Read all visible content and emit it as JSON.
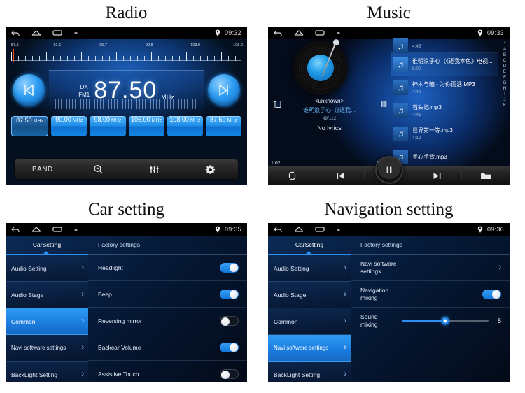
{
  "panels": {
    "radio": {
      "title": "Radio",
      "statusbar": {
        "time": "09:32",
        "icons": [
          "back-icon",
          "home-icon",
          "recents-icon",
          "square-icon",
          "location-pin-icon"
        ]
      },
      "scale": {
        "labels": [
          "87.5",
          "91.6",
          "95.7",
          "99.8",
          "103.9",
          "108.0"
        ],
        "cursor_label": "87.5"
      },
      "band_mode": "DX",
      "band": "FM1",
      "frequency": "87.50",
      "unit": "MHz",
      "prev_icon": "skip-previous-icon",
      "next_icon": "skip-next-icon",
      "presets": [
        {
          "value": "87.50",
          "unit": "MHz",
          "active": true
        },
        {
          "value": "90.00",
          "unit": "MHz",
          "active": false
        },
        {
          "value": "98.00",
          "unit": "MHz",
          "active": false
        },
        {
          "value": "106.00",
          "unit": "MHz",
          "active": false
        },
        {
          "value": "108.00",
          "unit": "MHz",
          "active": false
        },
        {
          "value": "87.50",
          "unit": "MHz",
          "active": false
        }
      ],
      "toolbar": {
        "band_label": "BAND",
        "scan_icon": "search-scan-icon",
        "equalizer_icon": "equalizer-icon",
        "settings_icon": "gear-icon"
      }
    },
    "music": {
      "title": "Music",
      "statusbar": {
        "time": "09:33"
      },
      "artist": "<unknown>",
      "now_playing": "谁明浪子心（《还我...",
      "track_index": "49/112",
      "lyrics": "No lyrics",
      "elapsed": "1:02",
      "duration": "5:00",
      "tracks": [
        {
          "name": "",
          "duration": "4:45",
          "selected": false
        },
        {
          "name": "谁明浪子心（《还我本色》电视...",
          "duration": "5:00",
          "selected": true
        },
        {
          "name": "神木与瞳 - 为你而活.MP3",
          "duration": "4:42",
          "selected": false
        },
        {
          "name": "石头记.mp3",
          "duration": "4:41",
          "selected": false
        },
        {
          "name": "世界第一等.mp3",
          "duration": "4:19",
          "selected": false
        },
        {
          "name": "手心手背.mp3",
          "duration": "",
          "selected": false
        }
      ],
      "alpha_index": [
        "*",
        "A",
        "B",
        "C",
        "D",
        "E",
        "F",
        "G",
        "H",
        "I",
        "J",
        "K"
      ],
      "toolbar": {
        "repeat_icon": "repeat-icon",
        "previous_icon": "skip-previous-icon",
        "play_pause_icon": "pause-icon",
        "next_icon": "skip-next-icon",
        "folder_icon": "folder-icon"
      }
    },
    "car_setting": {
      "title": "Car setting",
      "statusbar": {
        "time": "09:35"
      },
      "tabs": [
        {
          "label": "CarSetting",
          "active": true
        },
        {
          "label": "Factory settings",
          "active": false
        }
      ],
      "sidebar": [
        {
          "label": "Audio Setting",
          "active": false
        },
        {
          "label": "Audio Stage",
          "active": false
        },
        {
          "label": "Common",
          "active": true
        },
        {
          "label": "Navi software settings",
          "active": false
        },
        {
          "label": "BackLight Setting",
          "active": false
        }
      ],
      "rows": [
        {
          "label": "Headlight",
          "toggle": "on"
        },
        {
          "label": "Beep",
          "toggle": "on"
        },
        {
          "label": "Reversing mirror",
          "toggle": "off"
        },
        {
          "label": "Backcar Volume",
          "toggle": "on"
        },
        {
          "label": "Assistive Touch",
          "toggle": "off"
        }
      ]
    },
    "navigation_setting": {
      "title": "Navigation setting",
      "statusbar": {
        "time": "09:36"
      },
      "tabs": [
        {
          "label": "CarSetting",
          "active": true
        },
        {
          "label": "Factory settings",
          "active": false
        }
      ],
      "sidebar": [
        {
          "label": "Audio Setting",
          "active": false
        },
        {
          "label": "Audio Stage",
          "active": false
        },
        {
          "label": "Common",
          "active": false
        },
        {
          "label": "Navi software settings",
          "active": true
        },
        {
          "label": "BackLight Setting",
          "active": false
        }
      ],
      "rows": [
        {
          "line1": "Navi software",
          "line2": "settings",
          "control": "chevron"
        },
        {
          "line1": "Navigation",
          "line2": "mixing",
          "control": "toggle-on"
        },
        {
          "line1": "Sound",
          "line2": "mixing",
          "control": "slider",
          "value": "5"
        }
      ]
    }
  },
  "colors": {
    "accent_blue": "#2a8ff0",
    "toggle_on": "#1f86ee",
    "cursor_red": "#ff4a14",
    "page_bg": "#ffffff"
  }
}
